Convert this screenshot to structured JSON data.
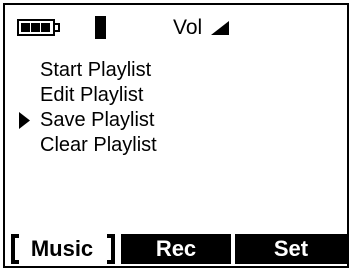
{
  "status": {
    "volume_label": "Vol",
    "battery_level": "3/3",
    "icons": [
      "battery-icon",
      "signal-bar-icon",
      "volume-ramp-icon"
    ]
  },
  "menu": {
    "items": [
      {
        "label": "Start Playlist",
        "selected": false
      },
      {
        "label": "Edit Playlist",
        "selected": false
      },
      {
        "label": "Save Playlist",
        "selected": true
      },
      {
        "label": "Clear Playlist",
        "selected": false
      }
    ]
  },
  "softkeys": {
    "music": "Music",
    "rec": "Rec",
    "set": "Set",
    "active": "Music"
  },
  "colors": {
    "foreground": "#000000",
    "background": "#ffffff"
  }
}
